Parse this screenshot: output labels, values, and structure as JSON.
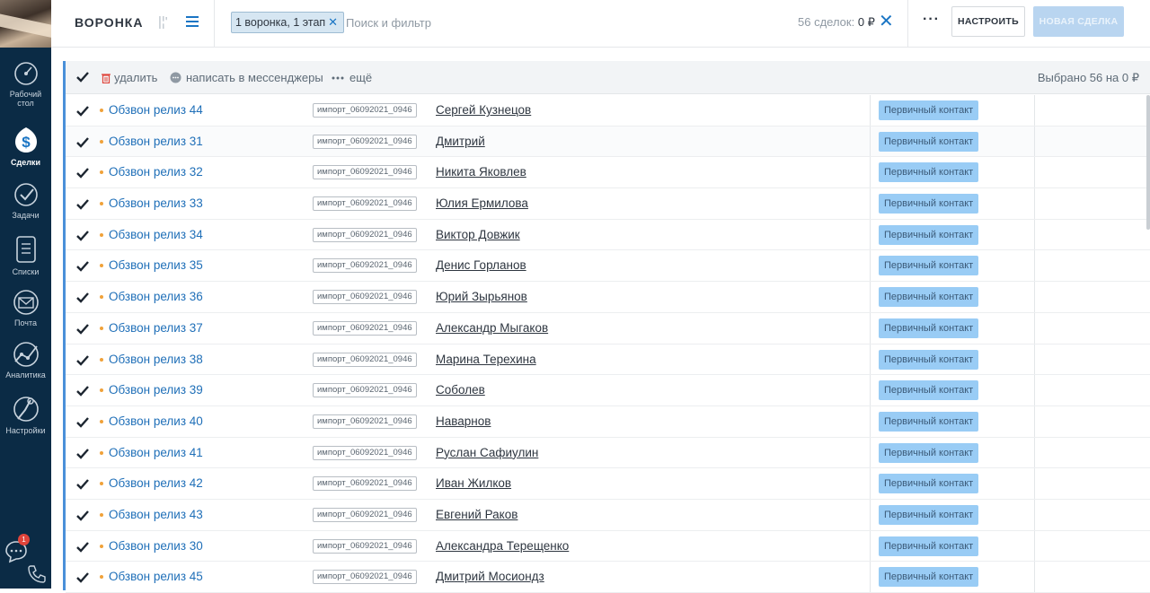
{
  "sidebar": {
    "items": [
      {
        "label_1": "Рабочий",
        "label_2": "стол"
      },
      {
        "label": "Сделки"
      },
      {
        "label": "Задачи"
      },
      {
        "label": "Списки"
      },
      {
        "label": "Почта"
      },
      {
        "label": "Аналитика"
      },
      {
        "label": "Настройки"
      }
    ],
    "chat_badge": "1"
  },
  "header": {
    "title": "ВОРОНКА",
    "filter_chip": "1 воронка, 1 этап",
    "filter_chip_close": "✕",
    "search_placeholder": "Поиск и фильтр",
    "deal_count_label": "56 сделок:",
    "deal_count_value": "0 ₽",
    "clear": "✕",
    "more": "···",
    "setup_button": "НАСТРОИТЬ",
    "new_deal_button": "НОВАЯ СДЕЛКА"
  },
  "actionbar": {
    "delete": "удалить",
    "messenger": "написать в мессенджеры",
    "more": "ещё",
    "selected": "Выбрано 56 на 0 ₽"
  },
  "rows": [
    {
      "deal": "Обзвон релиз 44",
      "tag": "импорт_06092021_0946",
      "contact": "Сергей Кузнецов",
      "stage": "Первичный контакт"
    },
    {
      "deal": "Обзвон релиз 31",
      "tag": "импорт_06092021_0946",
      "contact": "Дмитрий",
      "stage": "Первичный контакт"
    },
    {
      "deal": "Обзвон релиз 32",
      "tag": "импорт_06092021_0946",
      "contact": "Никита Яковлев",
      "stage": "Первичный контакт"
    },
    {
      "deal": "Обзвон релиз 33",
      "tag": "импорт_06092021_0946",
      "contact": "Юлия Ермилова",
      "stage": "Первичный контакт"
    },
    {
      "deal": "Обзвон релиз 34",
      "tag": "импорт_06092021_0946",
      "contact": "Виктор Довжик",
      "stage": "Первичный контакт"
    },
    {
      "deal": "Обзвон релиз 35",
      "tag": "импорт_06092021_0946",
      "contact": "Денис Горланов",
      "stage": "Первичный контакт"
    },
    {
      "deal": "Обзвон релиз 36",
      "tag": "импорт_06092021_0946",
      "contact": "Юрий Зырьянов",
      "stage": "Первичный контакт"
    },
    {
      "deal": "Обзвон релиз 37",
      "tag": "импорт_06092021_0946",
      "contact": "Александр Мыгаков",
      "stage": "Первичный контакт"
    },
    {
      "deal": "Обзвон релиз 38",
      "tag": "импорт_06092021_0946",
      "contact": "Марина Терехина",
      "stage": "Первичный контакт"
    },
    {
      "deal": "Обзвон релиз 39",
      "tag": "импорт_06092021_0946",
      "contact": "Соболев",
      "stage": "Первичный контакт"
    },
    {
      "deal": "Обзвон релиз 40",
      "tag": "импорт_06092021_0946",
      "contact": "Наварнов",
      "stage": "Первичный контакт"
    },
    {
      "deal": "Обзвон релиз 41",
      "tag": "импорт_06092021_0946",
      "contact": "Руслан Сафиулин",
      "stage": "Первичный контакт"
    },
    {
      "deal": "Обзвон релиз 42",
      "tag": "импорт_06092021_0946",
      "contact": "Иван Жилков",
      "stage": "Первичный контакт"
    },
    {
      "deal": "Обзвон релиз 43",
      "tag": "импорт_06092021_0946",
      "contact": "Евгений Раков",
      "stage": "Первичный контакт"
    },
    {
      "deal": "Обзвон релиз 30",
      "tag": "импорт_06092021_0946",
      "contact": "Александра Терещенко",
      "stage": "Первичный контакт"
    },
    {
      "deal": "Обзвон релиз 45",
      "tag": "импорт_06092021_0946",
      "contact": "Дмитрий Мосиондз",
      "stage": "Первичный контакт"
    }
  ],
  "colors": {
    "sidebar_bg": "#0b2b45",
    "accent_blue": "#1a75c4",
    "stage_badge": "#99ccf5",
    "deal_dot": "#f0a23a"
  }
}
